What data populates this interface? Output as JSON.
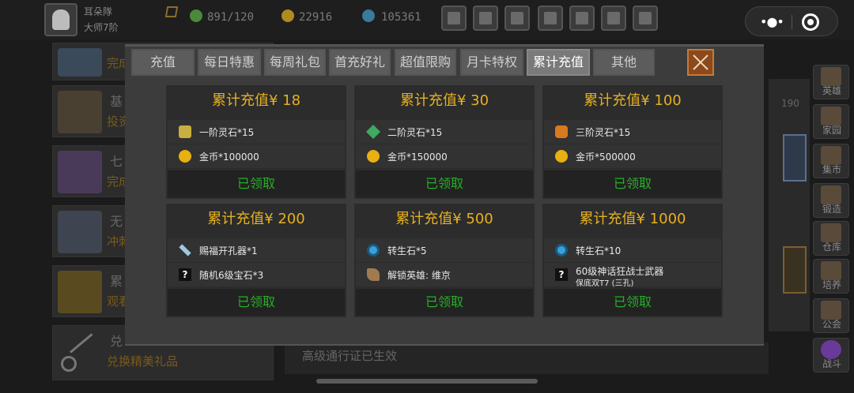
{
  "player": {
    "name": "耳朵隊",
    "rank": "大师7阶"
  },
  "resources": [
    {
      "icon": "lightning-icon",
      "value": "891/120",
      "color": "#4a8a3a"
    },
    {
      "icon": "gold-coin-icon",
      "value": "22916",
      "color": "#b08a20"
    },
    {
      "icon": "gem-icon",
      "value": "105361",
      "color": "#3a7a9a"
    }
  ],
  "top_buttons": [
    "shop-icon",
    "mail-icon",
    "flag-icon",
    "gear-icon",
    "gift-icon",
    "wheel-icon",
    "sword-icon"
  ],
  "left_list": [
    {
      "title": "",
      "subtitle": "完成"
    },
    {
      "title": "基",
      "subtitle": "投资"
    },
    {
      "title": "七",
      "subtitle": "完成"
    },
    {
      "title": "无",
      "subtitle": "冲刺"
    },
    {
      "title": "累",
      "subtitle": "观看"
    },
    {
      "title": "兑",
      "subtitle": "兑换精美礼品"
    }
  ],
  "right_panel": {
    "number": "190"
  },
  "side_nav": [
    "英雄",
    "家园",
    "集市",
    "锻造",
    "仓库",
    "培养",
    "公会",
    "战斗"
  ],
  "status_bar": {
    "text": "高级通行证已生效"
  },
  "tabs": [
    {
      "label": "充值",
      "active": false
    },
    {
      "label": "每日特惠",
      "active": false
    },
    {
      "label": "每周礼包",
      "active": false
    },
    {
      "label": "首充好礼",
      "active": false
    },
    {
      "label": "超值限购",
      "active": false
    },
    {
      "label": "月卡特权",
      "active": false
    },
    {
      "label": "累计充值",
      "active": true
    },
    {
      "label": "其他",
      "active": false
    }
  ],
  "cards": [
    {
      "title": "累计充值¥ 18",
      "status": "已领取",
      "rewards": [
        {
          "icon": "spirit-stone-1-icon",
          "color": "#c8b040",
          "text": "一阶灵石*15"
        },
        {
          "icon": "gold-coin-icon",
          "color": "#e8b010",
          "text": "金币*100000"
        }
      ]
    },
    {
      "title": "累计充值¥ 30",
      "status": "已领取",
      "rewards": [
        {
          "icon": "spirit-stone-2-icon",
          "color": "#40a860",
          "text": "二阶灵石*15"
        },
        {
          "icon": "gold-coin-icon",
          "color": "#e8b010",
          "text": "金币*150000"
        }
      ]
    },
    {
      "title": "累计充值¥ 100",
      "status": "已领取",
      "rewards": [
        {
          "icon": "spirit-stone-3-icon",
          "color": "#d87a20",
          "text": "三阶灵石*15"
        },
        {
          "icon": "gold-coin-icon",
          "color": "#e8b010",
          "text": "金币*500000"
        }
      ]
    },
    {
      "title": "累计充值¥ 200",
      "status": "已领取",
      "rewards": [
        {
          "icon": "drill-icon",
          "color": "#a0c8e0",
          "text": "赐福开孔器*1"
        },
        {
          "icon": "mystery-gem-icon",
          "color": "#111111",
          "text": "随机6级宝石*3"
        }
      ]
    },
    {
      "title": "累计充值¥ 500",
      "status": "已领取",
      "rewards": [
        {
          "icon": "rebirth-stone-icon",
          "color": "#3aa0d8",
          "text": "转生石*5"
        },
        {
          "icon": "hero-unlock-icon",
          "color": "#a07a50",
          "text": "解锁英雄: 维京"
        }
      ]
    },
    {
      "title": "累计充值¥ 1000",
      "status": "已领取",
      "rewards": [
        {
          "icon": "rebirth-stone-icon",
          "color": "#3aa0d8",
          "text": "转生石*10"
        },
        {
          "icon": "mystery-weapon-icon",
          "color": "#111111",
          "text": "60级神话狂战士武器",
          "subtext": "保底双T7 (三孔)"
        }
      ]
    }
  ]
}
